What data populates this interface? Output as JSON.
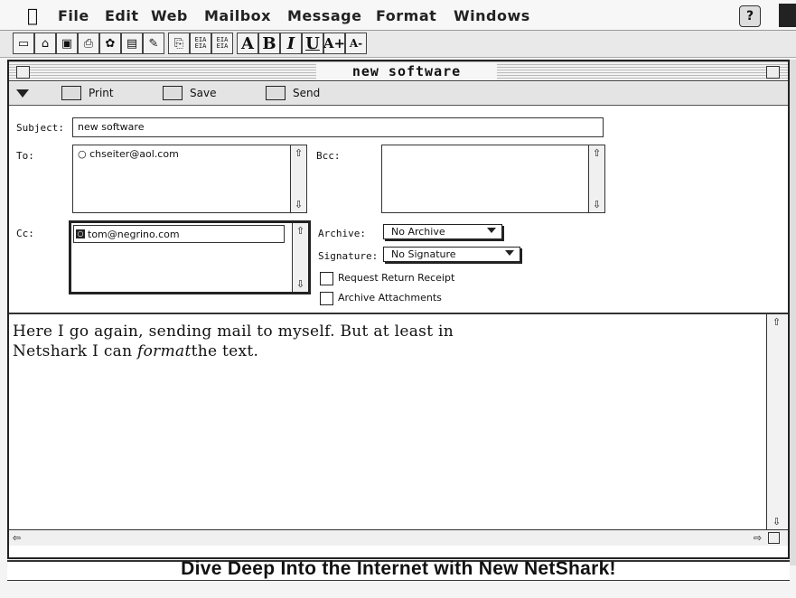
{
  "menubar": {
    "items": [
      "File",
      "Edit",
      "Web",
      "Mailbox",
      "Message",
      "Format",
      "Windows"
    ],
    "help_icon": "?"
  },
  "toolbar": {
    "buttons": [
      "new-doc",
      "open",
      "save",
      "print",
      "sprocket",
      "mailbox",
      "compose",
      "attach",
      "find",
      "outbox",
      "inbox"
    ],
    "font_styles": [
      "A",
      "B",
      "I",
      "U",
      "A+",
      "A-"
    ]
  },
  "window": {
    "title": "new software"
  },
  "actions": {
    "print": "Print",
    "save": "Save",
    "send": "Send"
  },
  "fields": {
    "subject_label": "Subject:",
    "subject_value": "new software",
    "to_label": "To:",
    "to_value": "chseiter@aol.com",
    "bcc_label": "Bcc:",
    "cc_label": "Cc:",
    "cc_value": "tom@negrino.com",
    "archive_label": "Archive:",
    "archive_value": "No Archive",
    "signature_label": "Signature:",
    "signature_value": "No Signature",
    "request_receipt": "Request Return Receipt",
    "archive_attachments": "Archive Attachments"
  },
  "body": {
    "line1": "Here I go again, sending mail to myself. But at least in",
    "line2_a": "Netshark I can ",
    "line2_b": "format",
    "line2_c": "the text."
  },
  "background": {
    "banner": "Dive Deep Into the Internet with New NetShark!"
  }
}
